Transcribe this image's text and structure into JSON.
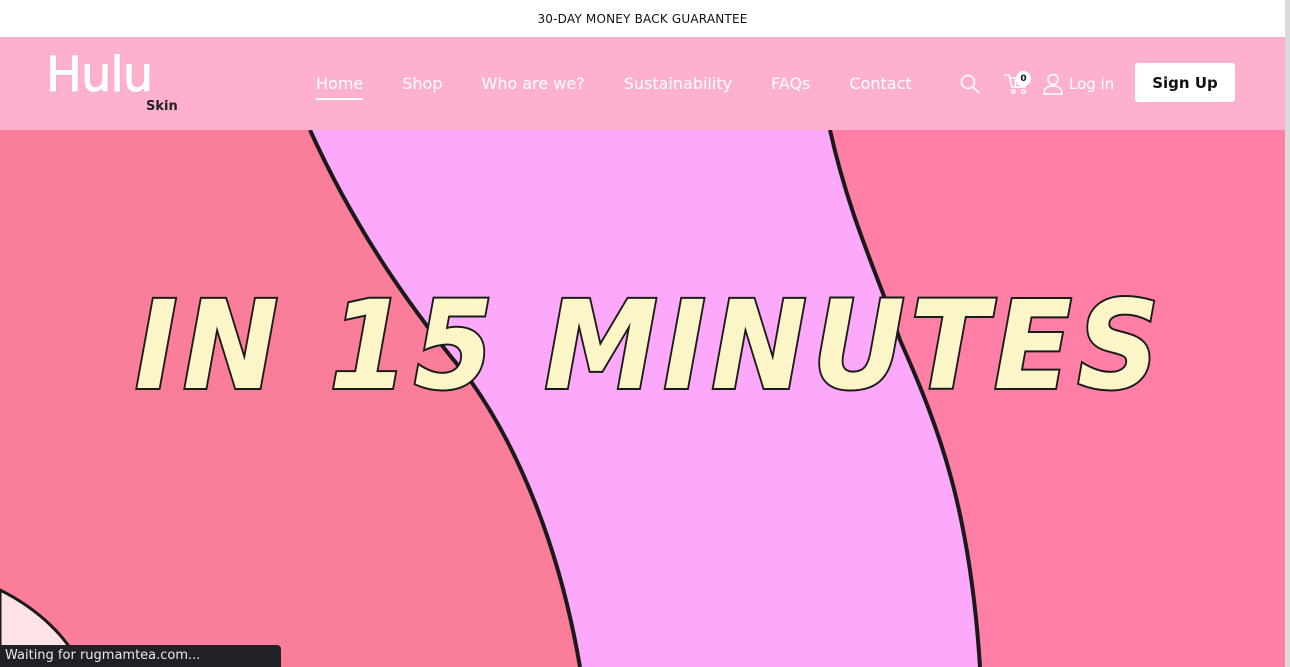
{
  "announcement": {
    "text": "30-DAY MONEY BACK GUARANTEE"
  },
  "header": {
    "logo": {
      "main": "Hulu",
      "sub": "Skin"
    },
    "nav": [
      {
        "label": "Home",
        "active": true
      },
      {
        "label": "Shop",
        "active": false
      },
      {
        "label": "Who are we?",
        "active": false
      },
      {
        "label": "Sustainability",
        "active": false
      },
      {
        "label": "FAQs",
        "active": false
      },
      {
        "label": "Contact",
        "active": false
      }
    ],
    "icons": {
      "search": "search-icon",
      "cart": "cart-icon",
      "account": "user-icon"
    },
    "cart_count": "0",
    "login_label": "Log in",
    "signup_label": "Sign Up"
  },
  "hero": {
    "headline": "IN 15 MINUTES",
    "colors": {
      "background": "#ff7fa6",
      "left_stripe": "#fa7e99",
      "center_stripe": "#fda9fb",
      "text_fill": "#fcf5c7",
      "outline": "#1a1a1a"
    }
  },
  "status_bar": {
    "text": "Waiting for rugmamtea.com..."
  },
  "colors": {
    "header_bg": "#fdb1cf",
    "announcement_bg": "#ffffff",
    "signup_bg": "#ffffff"
  }
}
